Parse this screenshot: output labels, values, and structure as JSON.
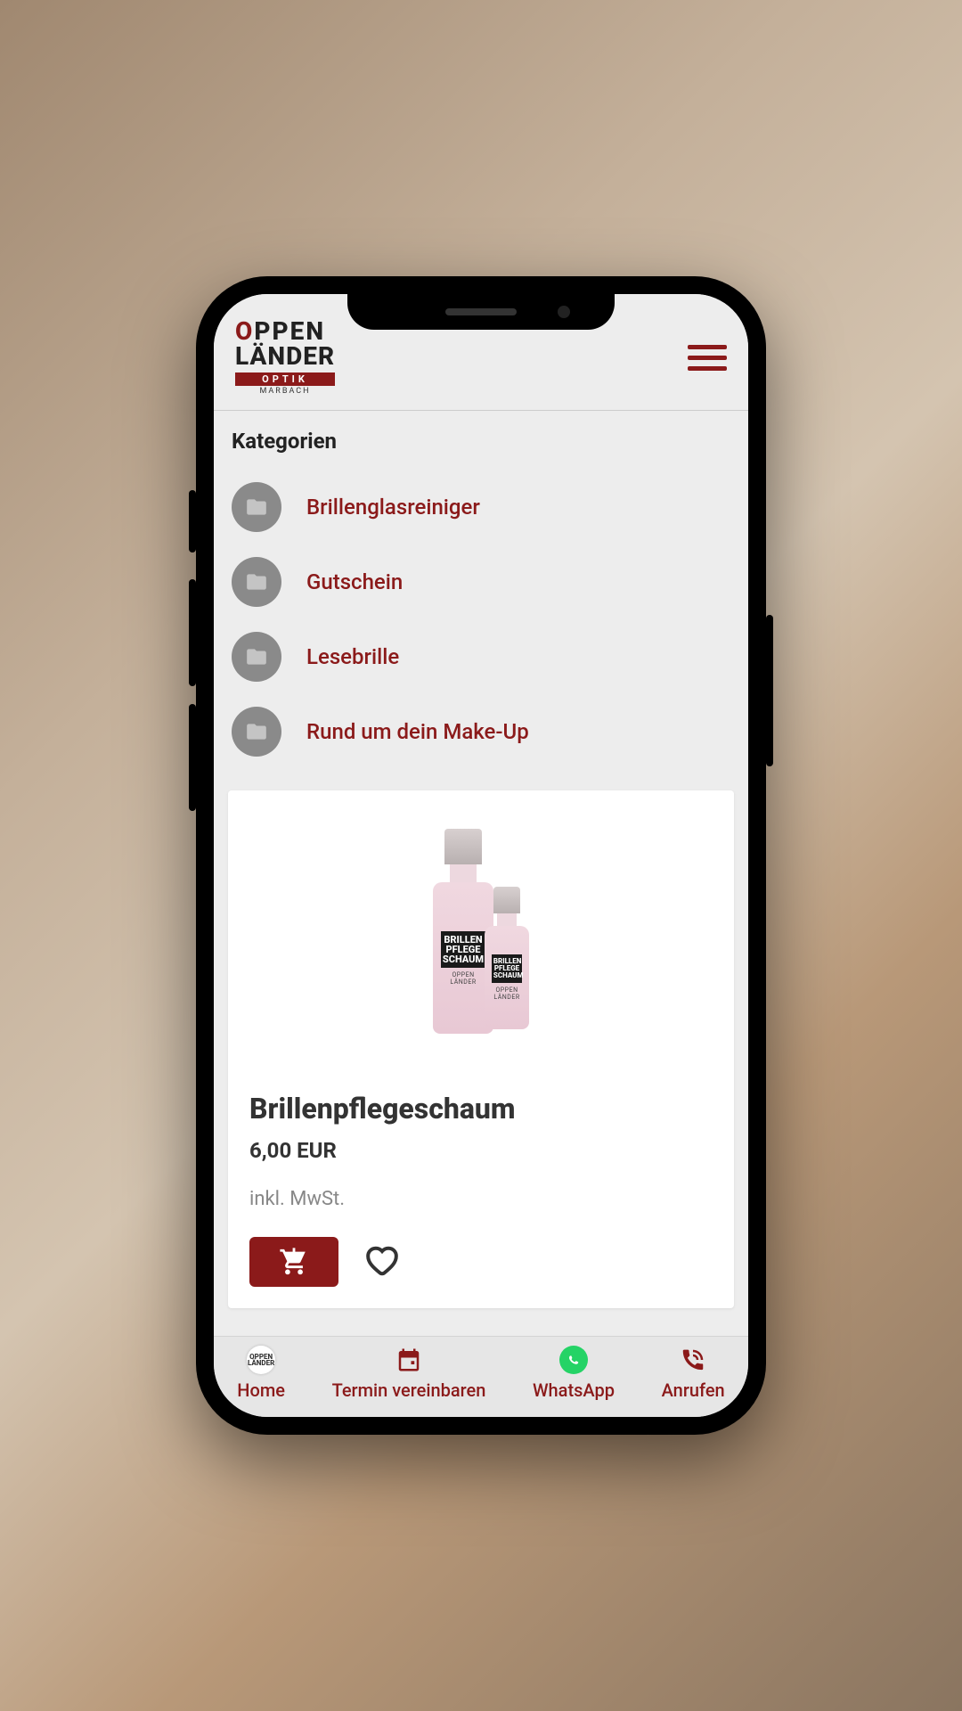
{
  "brand": {
    "line1_first": "O",
    "line1_rest": "PPEN",
    "line2": "LÄNDER",
    "optik": "OPTIK",
    "sub": "MARBACH"
  },
  "categories": {
    "title": "Kategorien",
    "items": [
      {
        "label": "Brillenglasreiniger"
      },
      {
        "label": "Gutschein"
      },
      {
        "label": "Lesebrille"
      },
      {
        "label": "Rund um dein Make-Up"
      }
    ]
  },
  "product": {
    "title": "Brillenpflegeschaum",
    "price": "6,00 EUR",
    "note": "inkl. MwSt.",
    "bottle_label": "BRILLEN PFLEGE SCHAUM",
    "bottle_brand": "OPPEN LÄNDER"
  },
  "nav": {
    "home": "Home",
    "termin": "Termin vereinbaren",
    "whatsapp": "WhatsApp",
    "anrufen": "Anrufen"
  }
}
